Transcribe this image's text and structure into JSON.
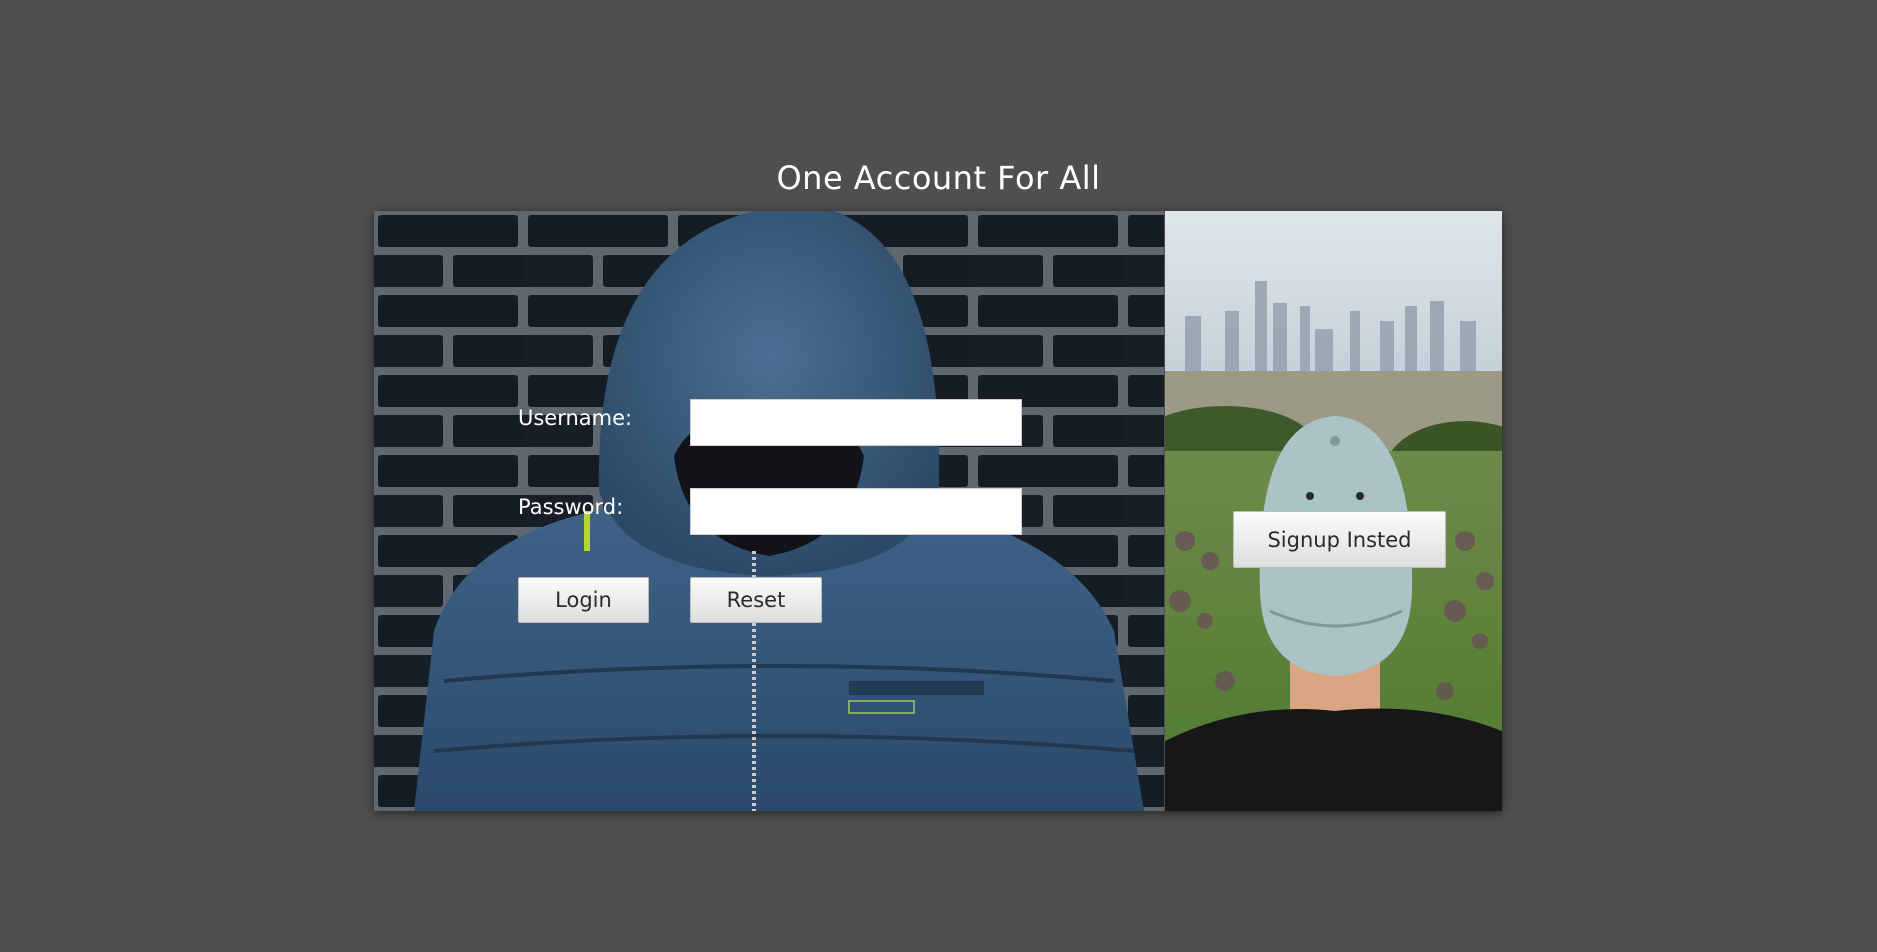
{
  "page": {
    "title": "One Account For All"
  },
  "login_form": {
    "username_label": "Username:",
    "username_value": "",
    "password_label": "Password:",
    "password_value": "",
    "login_label": "Login",
    "reset_label": "Reset"
  },
  "signup": {
    "button_label": "Signup Insted"
  },
  "colors": {
    "page_background": "#4f4f4f",
    "title_text": "#ffffff",
    "input_background": "#ffffff",
    "button_background": "#f0f0f0"
  }
}
